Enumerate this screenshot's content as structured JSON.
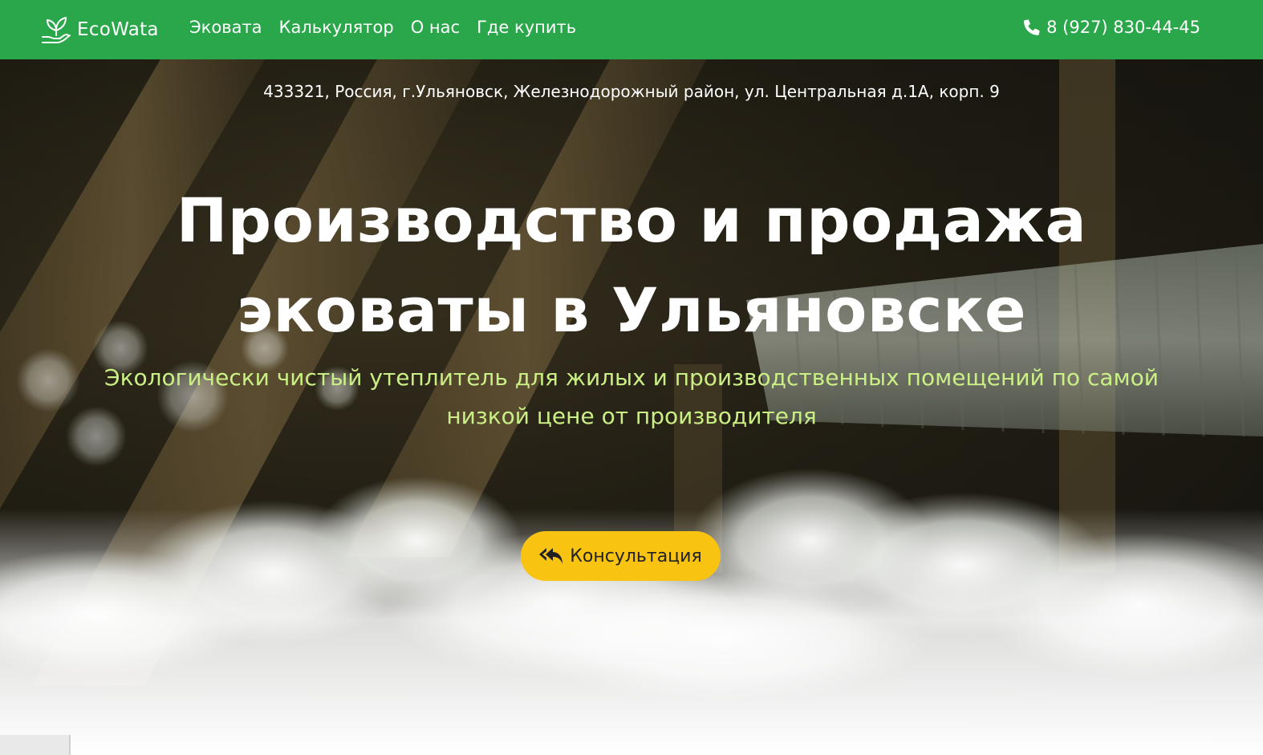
{
  "header": {
    "brand": "EcoWata",
    "brand_icon": "leaf-hand-icon",
    "nav": [
      "Эковата",
      "Калькулятор",
      "О нас",
      "Где купить"
    ],
    "phone": "8 (927) 830-44-45",
    "phone_icon": "phone-icon",
    "background_color": "#2aa74a"
  },
  "hero": {
    "address": "433321, Россия, г.Ульяновск, Железнодорожный район, ул. Центральная д.1А, корп. 9",
    "title_line1": "Производство и продажа",
    "title_line2": "эковаты в Ульяновске",
    "subtitle_line1": "Экологически чистый утеплитель для жилых и производственных помещений по самой",
    "subtitle_line2": "низкой цене от производителя",
    "subtitle_color": "#c9ef85",
    "cta_label": "Консультация",
    "cta_icon": "reply-all-icon",
    "cta_color": "#f9c312",
    "background_image": "attic-insulation-blowing-photo"
  }
}
